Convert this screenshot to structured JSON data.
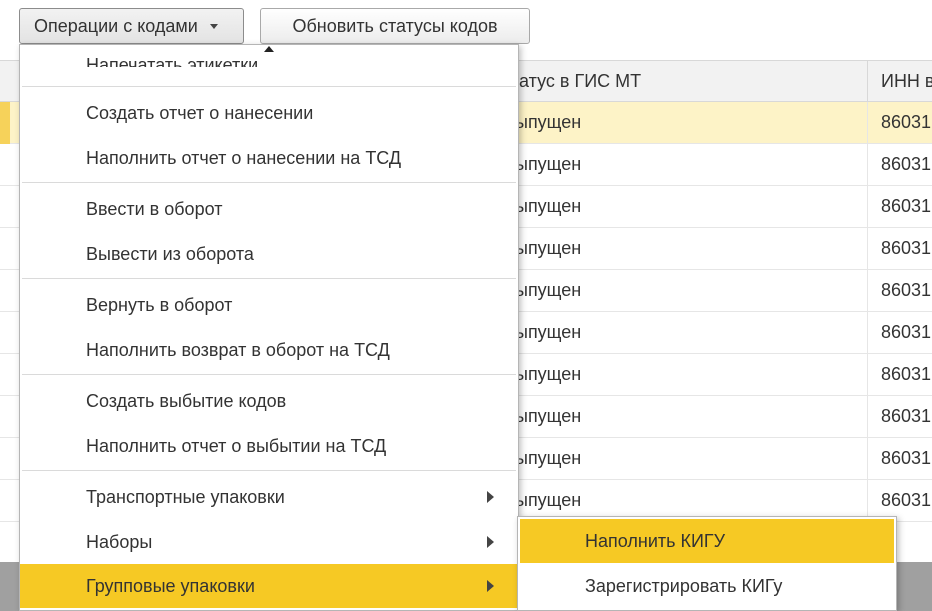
{
  "toolbar": {
    "operations_label": "Операции с кодами",
    "refresh_label": "Обновить статусы кодов"
  },
  "table": {
    "columns": [
      "татус в ГИС МТ",
      "ИНН в"
    ],
    "rows": [
      {
        "status": "ыпущен",
        "inn": "86031",
        "selected": true
      },
      {
        "status": "ыпущен",
        "inn": "86031"
      },
      {
        "status": "ыпущен",
        "inn": "86031"
      },
      {
        "status": "ыпущен",
        "inn": "86031"
      },
      {
        "status": "ыпущен",
        "inn": "86031"
      },
      {
        "status": "ыпущен",
        "inn": "86031"
      },
      {
        "status": "ыпущен",
        "inn": "86031"
      },
      {
        "status": "ыпущен",
        "inn": "86031"
      },
      {
        "status": "ыпущен",
        "inn": "86031"
      },
      {
        "status": "ыпущен",
        "inn": "86031"
      }
    ]
  },
  "menu": {
    "items": [
      {
        "label": "Напечатать этикетки"
      },
      {
        "label": "Создать отчет о нанесении"
      },
      {
        "label": "Наполнить отчет о нанесении на ТСД"
      },
      {
        "label": "Ввести в оборот"
      },
      {
        "label": "Вывести из оборота"
      },
      {
        "label": "Вернуть в оборот"
      },
      {
        "label": "Наполнить возврат в оборот на ТСД"
      },
      {
        "label": "Создать выбытие кодов"
      },
      {
        "label": "Наполнить отчет о выбытии на ТСД"
      },
      {
        "label": "Транспортные упаковки",
        "submenu": true
      },
      {
        "label": "Наборы",
        "submenu": true
      },
      {
        "label": "Групповые упаковки",
        "submenu": true,
        "active": true
      }
    ]
  },
  "submenu": {
    "items": [
      {
        "label": "Наполнить КИГУ",
        "active": true
      },
      {
        "label": "Зарегистрировать КИГу"
      }
    ]
  },
  "colors": {
    "highlight": "#f6c924",
    "selected_row": "#fdf3c7"
  }
}
